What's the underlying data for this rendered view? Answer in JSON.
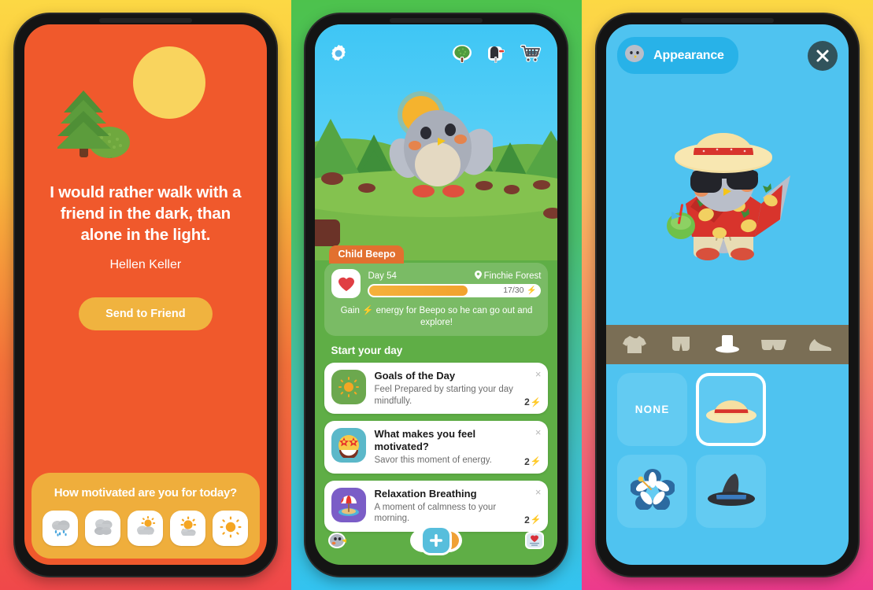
{
  "panels": {
    "quote": {
      "quote_text": "I would rather walk with a friend in the dark, than alone in the light.",
      "author": "Hellen Keller",
      "send_button": "Send to Friend",
      "mood_title": "How motivated are you for today?",
      "art_icon": "sun-and-trees-illustration",
      "moods": [
        {
          "name": "mood-rain",
          "label": "rain-cloud-icon"
        },
        {
          "name": "mood-cloudy",
          "label": "cloud-icon"
        },
        {
          "name": "mood-partly-cloudy",
          "label": "sun-behind-cloud-icon"
        },
        {
          "name": "mood-mostly-sunny",
          "label": "sun-with-small-cloud-icon"
        },
        {
          "name": "mood-sunny",
          "label": "sun-icon"
        }
      ]
    },
    "home": {
      "topbar": {
        "settings": "gear-icon",
        "tree": "tree-icon",
        "mailbox": "mailbox-icon",
        "shop": "shopping-cart-icon"
      },
      "character_name": "Child Beepo",
      "day_label": "Day 54",
      "location": "Finchie Forest",
      "location_icon": "map-pin-icon",
      "energy_current": 17,
      "energy_max": 30,
      "energy_text": "17/30",
      "energy_icon": "lightning-bolt-icon",
      "heart_icon": "heart-icon",
      "hint_text": "Gain ⚡ energy for Beepo so he can go out and explore!",
      "section_title": "Start your day",
      "activities": [
        {
          "title": "Goals of the Day",
          "desc": "Feel Prepared by starting your day mindfully.",
          "cost": "2",
          "thumb": "sun-emoji-icon",
          "thumb_bg": "#6CA84E",
          "close": "×"
        },
        {
          "title": "What makes you feel motivated?",
          "desc": "Savor this moment of energy.",
          "cost": "2",
          "thumb": "star-struck-emoji-icon",
          "thumb_bg": "#5BB8C9",
          "close": "×"
        },
        {
          "title": "Relaxation Breathing",
          "desc": "A moment of calmness to your morning.",
          "cost": "2",
          "thumb": "beach-umbrella-emoji-icon",
          "thumb_bg": "#7B5DC7",
          "close": "×"
        }
      ],
      "nav": {
        "left": "penguin-avatar-icon",
        "center": "add-button-icon",
        "center_label": "+",
        "right": "journal-card-icon"
      }
    },
    "appearance": {
      "title": "Appearance",
      "avatar_icon": "penguin-head-icon",
      "close_icon": "close-icon",
      "avatar_preview": "penguin-beach-outfit-avatar",
      "categories": [
        {
          "name": "category-shirt",
          "icon": "tshirt-icon",
          "selected": false
        },
        {
          "name": "category-pants",
          "icon": "shorts-icon",
          "selected": false
        },
        {
          "name": "category-hat",
          "icon": "top-hat-icon",
          "selected": true
        },
        {
          "name": "category-glasses",
          "icon": "sunglasses-icon",
          "selected": false
        },
        {
          "name": "category-shoes",
          "icon": "shoe-icon",
          "selected": false
        }
      ],
      "items": [
        {
          "name": "item-none",
          "label": "NONE",
          "icon": "none",
          "selected": false
        },
        {
          "name": "item-straw-hat",
          "label": "",
          "icon": "straw-hat-icon",
          "selected": true
        },
        {
          "name": "item-flower",
          "label": "",
          "icon": "hibiscus-flower-icon",
          "selected": false
        },
        {
          "name": "item-witch-hat",
          "label": "",
          "icon": "witch-hat-icon",
          "selected": false
        }
      ]
    }
  },
  "colors": {
    "quote_bg": "#F0592C",
    "quote_accent": "#F0B33F",
    "home_green": "#5FAE46",
    "appearance_blue": "#4FC3F0",
    "energy_orange": "#F5B13B"
  }
}
